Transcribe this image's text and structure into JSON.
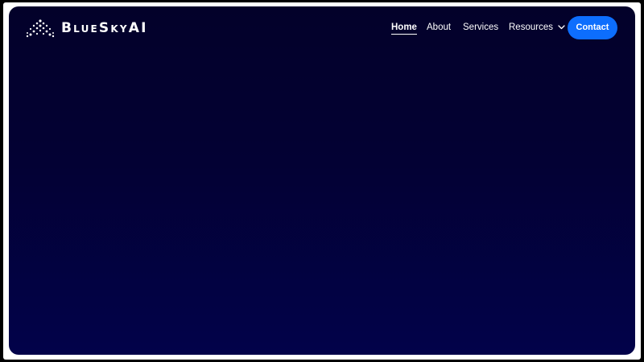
{
  "brand": {
    "name": "BlueSkyAI",
    "logo_icon": "dotted-sky-constellation-icon"
  },
  "nav": {
    "items": [
      {
        "label": "Home",
        "active": true
      },
      {
        "label": "About",
        "active": false
      },
      {
        "label": "Services",
        "active": false
      },
      {
        "label": "Resources",
        "active": false,
        "icon": "chevron-down-icon"
      }
    ],
    "cta_label": "Contact"
  },
  "colors": {
    "background_top": "#03012a",
    "background_bottom": "#02024a",
    "accent": "#0d6efd",
    "nav_text": "#ffffff",
    "frame": "#ffffff"
  }
}
